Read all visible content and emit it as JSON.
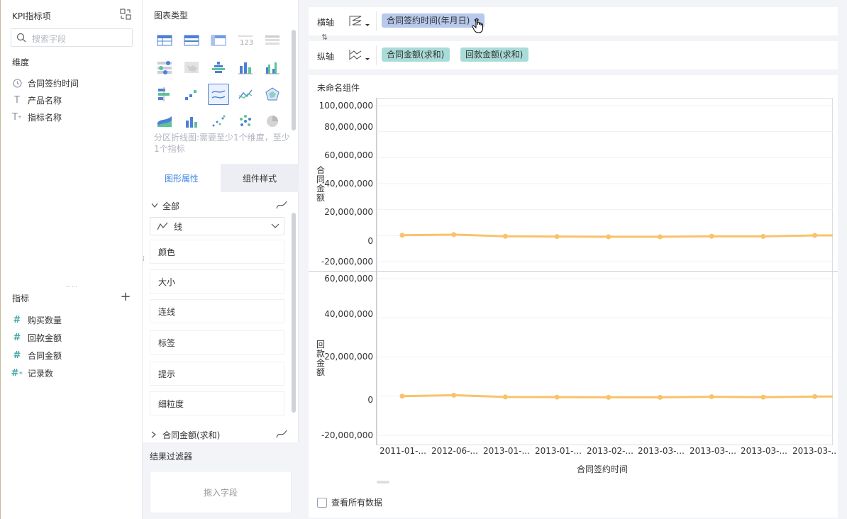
{
  "left": {
    "title": "KPI指标项",
    "search_placeholder": "搜索字段",
    "dimensions_title": "维度",
    "dimensions": [
      {
        "label": "合同签约时间",
        "icon": "clock-icon"
      },
      {
        "label": "产品名称",
        "icon": "text-icon"
      },
      {
        "label": "指标名称",
        "icon": "text-plus-icon"
      }
    ],
    "measures_title": "指标",
    "measures": [
      {
        "label": "购买数量",
        "icon": "hash-icon"
      },
      {
        "label": "回款金额",
        "icon": "hash-icon"
      },
      {
        "label": "合同金额",
        "icon": "hash-icon"
      },
      {
        "label": "记录数",
        "icon": "hash-plus-icon"
      }
    ]
  },
  "middle": {
    "chart_type_title": "图表类型",
    "chart_hint": "分区折线图:需要至少1个维度，至少1个指标",
    "tabs": [
      "图形属性",
      "组件样式"
    ],
    "all_label": "全部",
    "mark_type": "线",
    "properties": [
      "颜色",
      "大小",
      "连线",
      "标签",
      "提示",
      "细粒度"
    ],
    "sub_series": "合同金额(求和)",
    "filter_title": "结果过滤器",
    "filter_drop": "拖入字段"
  },
  "axes": {
    "x_label": "横轴",
    "y_label": "纵轴",
    "x_fields": [
      "合同签约时间(年月日)"
    ],
    "y_fields": [
      "合同金额(求和)",
      "回款金额(求和)"
    ]
  },
  "chart": {
    "component_title": "未命名组件",
    "show_all_label": "查看所有数据",
    "colors": {
      "line": "#f8c36a"
    }
  },
  "chart_data": [
    {
      "type": "line",
      "ylabel": "合同金额",
      "xlabel": "合同签约时间",
      "ylim": [
        -20000000,
        100000000
      ],
      "yticks": [
        "100,000,000",
        "80,000,000",
        "60,000,000",
        "40,000,000",
        "20,000,000",
        "0",
        "-20,000,000"
      ],
      "categories": [
        "2011-01-...",
        "2012-06-...",
        "2013-01-...",
        "2013-01-...",
        "2013-02-...",
        "2013-03-...",
        "2013-03-...",
        "2013-03-...",
        "2013-03-..."
      ],
      "series": [
        {
          "values": [
            300000,
            800000,
            -500000,
            -700000,
            -900000,
            -900000,
            -500000,
            -600000,
            200000
          ]
        }
      ]
    },
    {
      "type": "line",
      "ylabel": "回款金额",
      "xlabel": "合同签约时间",
      "ylim": [
        -20000000,
        60000000
      ],
      "yticks": [
        "60,000,000",
        "40,000,000",
        "20,000,000",
        "0",
        "-20,000,000"
      ],
      "categories": [
        "2011-01-...",
        "2012-06-...",
        "2013-01-...",
        "2013-01-...",
        "2013-02-...",
        "2013-03-...",
        "2013-03-...",
        "2013-03-...",
        "2013-03-..."
      ],
      "series": [
        {
          "values": [
            0,
            500000,
            -400000,
            -500000,
            -600000,
            -600000,
            -300000,
            -500000,
            -200000
          ]
        }
      ]
    }
  ]
}
